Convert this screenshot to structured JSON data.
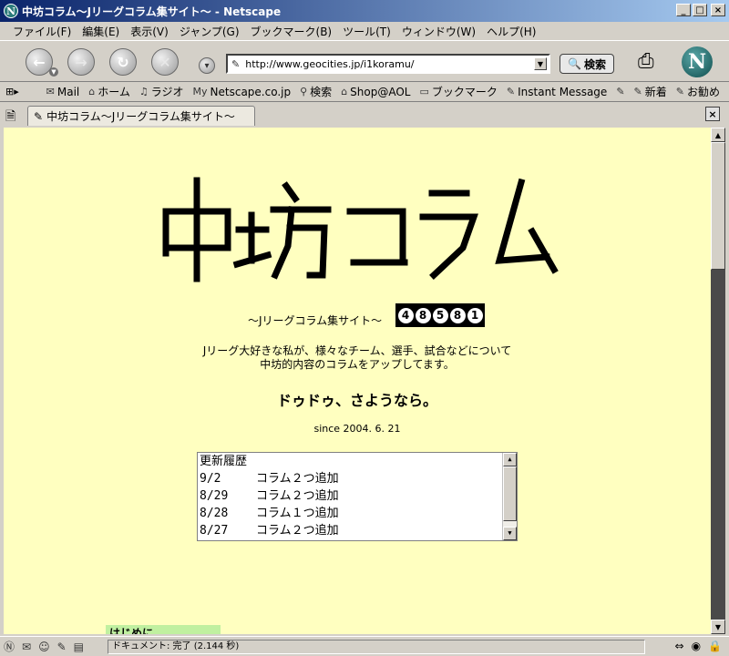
{
  "window": {
    "title": "中坊コラム〜Jリーグコラム集サイト〜 - Netscape"
  },
  "menu": [
    "ファイル(F)",
    "編集(E)",
    "表示(V)",
    "ジャンプ(G)",
    "ブックマーク(B)",
    "ツール(T)",
    "ウィンドウ(W)",
    "ヘルプ(H)"
  ],
  "nav": {
    "url": "http://www.geocities.jp/i1koramu/",
    "search_label": "検索"
  },
  "personal_toolbar": [
    {
      "label": "Mail",
      "icon": "mail-icon"
    },
    {
      "label": "ホーム",
      "icon": "home-icon"
    },
    {
      "label": "ラジオ",
      "icon": "radio-icon"
    },
    {
      "label": "Netscape.co.jp",
      "icon": "my-netscape-icon"
    },
    {
      "label": "検索",
      "icon": "search-icon"
    },
    {
      "label": "Shop@AOL",
      "icon": "shop-icon"
    },
    {
      "label": "ブックマーク",
      "icon": "bookmark-folder-icon"
    },
    {
      "label": "Instant Message",
      "icon": "link-icon"
    },
    {
      "label": "新着",
      "icon": "link-icon"
    },
    {
      "label": "お勧め",
      "icon": "link-icon"
    }
  ],
  "tab": {
    "title": "中坊コラム〜Jリーグコラム集サイト〜"
  },
  "page": {
    "tagline": "〜Jリーグコラム集サイト〜",
    "counter_digits": [
      "4",
      "8",
      "5",
      "8",
      "1"
    ],
    "intro_line1": "Jリーグ大好きな私が、様々なチーム、選手、試合などについて",
    "intro_line2": "中坊的内容のコラムをアップしてます。",
    "farewell": "ドゥドゥ、さようなら。",
    "since": "since 2004. 6. 21",
    "history": {
      "title": "更新履歴",
      "items": [
        {
          "date": "9/2",
          "text": "コラム２つ追加"
        },
        {
          "date": "8/29",
          "text": "コラム２つ追加"
        },
        {
          "date": "8/28",
          "text": "コラム１つ追加"
        },
        {
          "date": "8/27",
          "text": "コラム２つ追加"
        }
      ]
    },
    "green_label": "はじめに"
  },
  "status": {
    "text": "ドキュメント: 完了 (2.144 秒)"
  },
  "colors": {
    "page_background": "#ffffc0",
    "title_bar": "#0a246a"
  }
}
